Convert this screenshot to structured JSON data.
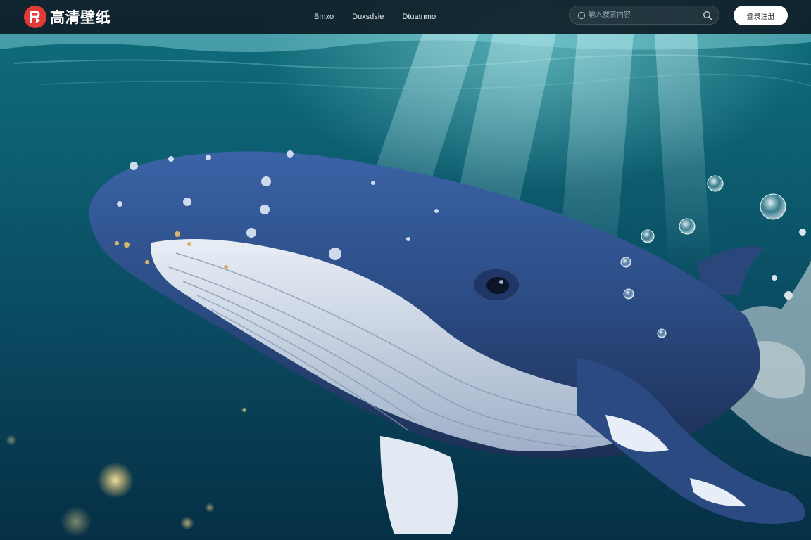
{
  "header": {
    "brand_name": "高清壁纸",
    "nav": [
      {
        "label": "Bmxo"
      },
      {
        "label": "Duxsdsie"
      },
      {
        "label": "Dtuatnmo"
      }
    ],
    "search": {
      "placeholder": "输入搜索内容"
    },
    "login_label": "登录注册"
  },
  "hero": {
    "image_subject": "humpback-whale-underwater"
  },
  "colors": {
    "brand_red": "#e23a36",
    "header_bg": "#101e28",
    "water_top": "#0f6f7c",
    "water_bottom": "#062f45",
    "whale_blue": "#2e4f87"
  },
  "icons": {
    "logo": "brand-logo-icon",
    "search_lead": "search-icon",
    "search_button": "search-icon"
  }
}
